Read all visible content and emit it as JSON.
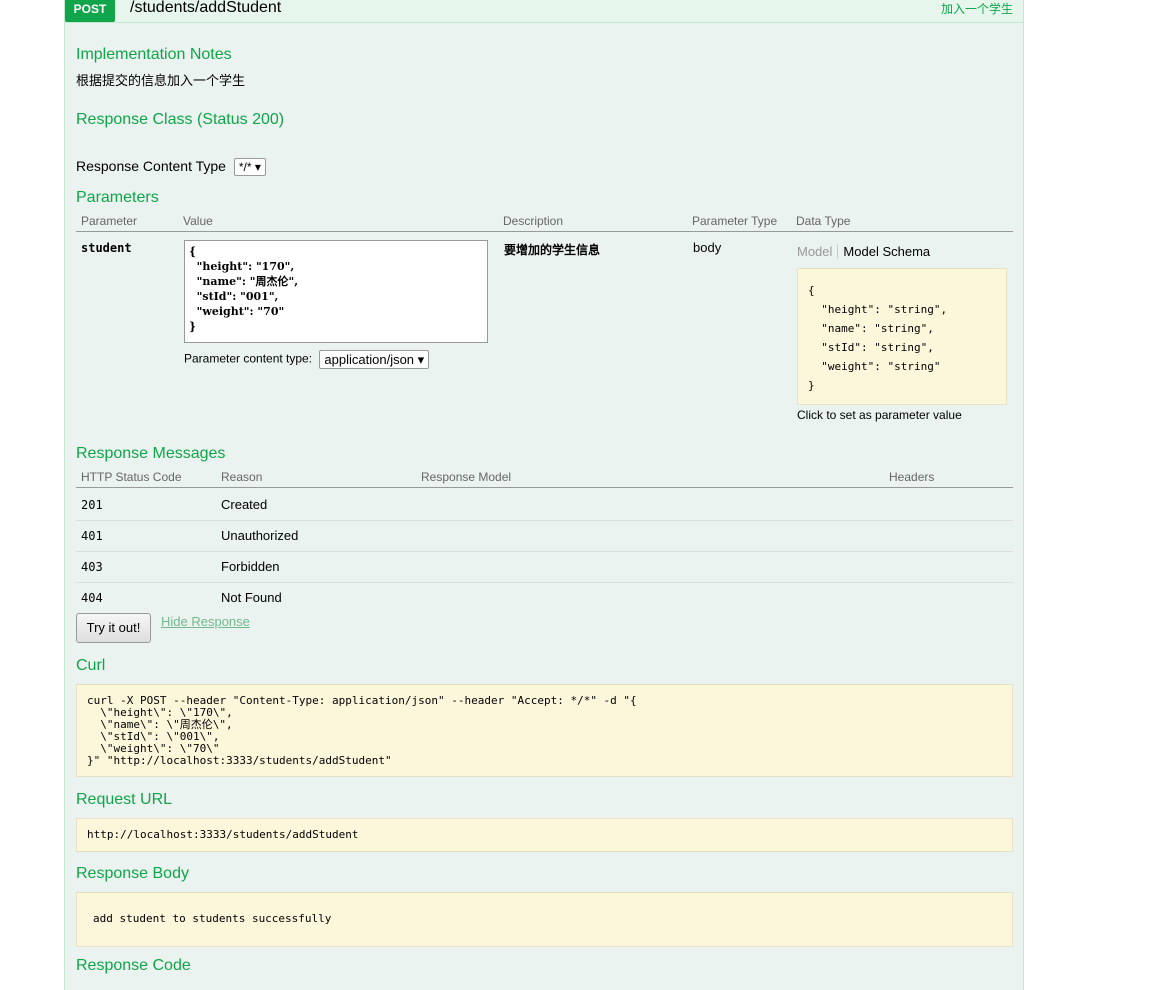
{
  "operation": {
    "method": "POST",
    "path": "/students/addStudent",
    "summary": "加入一个学生"
  },
  "implementation_notes": {
    "heading": "Implementation Notes",
    "text": "根据提交的信息加入一个学生"
  },
  "response_class": {
    "heading": "Response Class (Status 200)"
  },
  "response_content_type": {
    "label": "Response Content Type",
    "selected": "*/*"
  },
  "parameters": {
    "heading": "Parameters",
    "columns": [
      "Parameter",
      "Value",
      "Description",
      "Parameter Type",
      "Data Type"
    ],
    "rows": [
      {
        "name": "student",
        "value": "{\n  \"height\": \"170\",\n  \"name\": \"周杰伦\",\n  \"stId\": \"001\",\n  \"weight\": \"70\"\n}",
        "content_type_label": "Parameter content type:",
        "content_type": "application/json",
        "description": "要增加的学生信息",
        "param_type": "body",
        "model_tab": "Model",
        "schema_tab": "Model Schema",
        "schema": "{\n  \"height\": \"string\",\n  \"name\": \"string\",\n  \"stId\": \"string\",\n  \"weight\": \"string\"\n}",
        "hint": "Click to set as parameter value"
      }
    ]
  },
  "response_messages": {
    "heading": "Response Messages",
    "columns": [
      "HTTP Status Code",
      "Reason",
      "Response Model",
      "Headers"
    ],
    "rows": [
      {
        "code": "201",
        "reason": "Created"
      },
      {
        "code": "401",
        "reason": "Unauthorized"
      },
      {
        "code": "403",
        "reason": "Forbidden"
      },
      {
        "code": "404",
        "reason": "Not Found"
      }
    ]
  },
  "actions": {
    "try_label": "Try it out!",
    "hide_label": "Hide Response"
  },
  "curl": {
    "heading": "Curl",
    "text": "curl -X POST --header \"Content-Type: application/json\" --header \"Accept: */*\" -d \"{\n  \\\"height\\\": \\\"170\\\",\n  \\\"name\\\": \\\"周杰伦\\\",\n  \\\"stId\\\": \\\"001\\\",\n  \\\"weight\\\": \\\"70\\\"\n}\" \"http://localhost:3333/students/addStudent\""
  },
  "request_url": {
    "heading": "Request URL",
    "text": "http://localhost:3333/students/addStudent"
  },
  "response_body": {
    "heading": "Response Body",
    "text": "add student to students successfully"
  },
  "response_code": {
    "heading": "Response Code"
  }
}
